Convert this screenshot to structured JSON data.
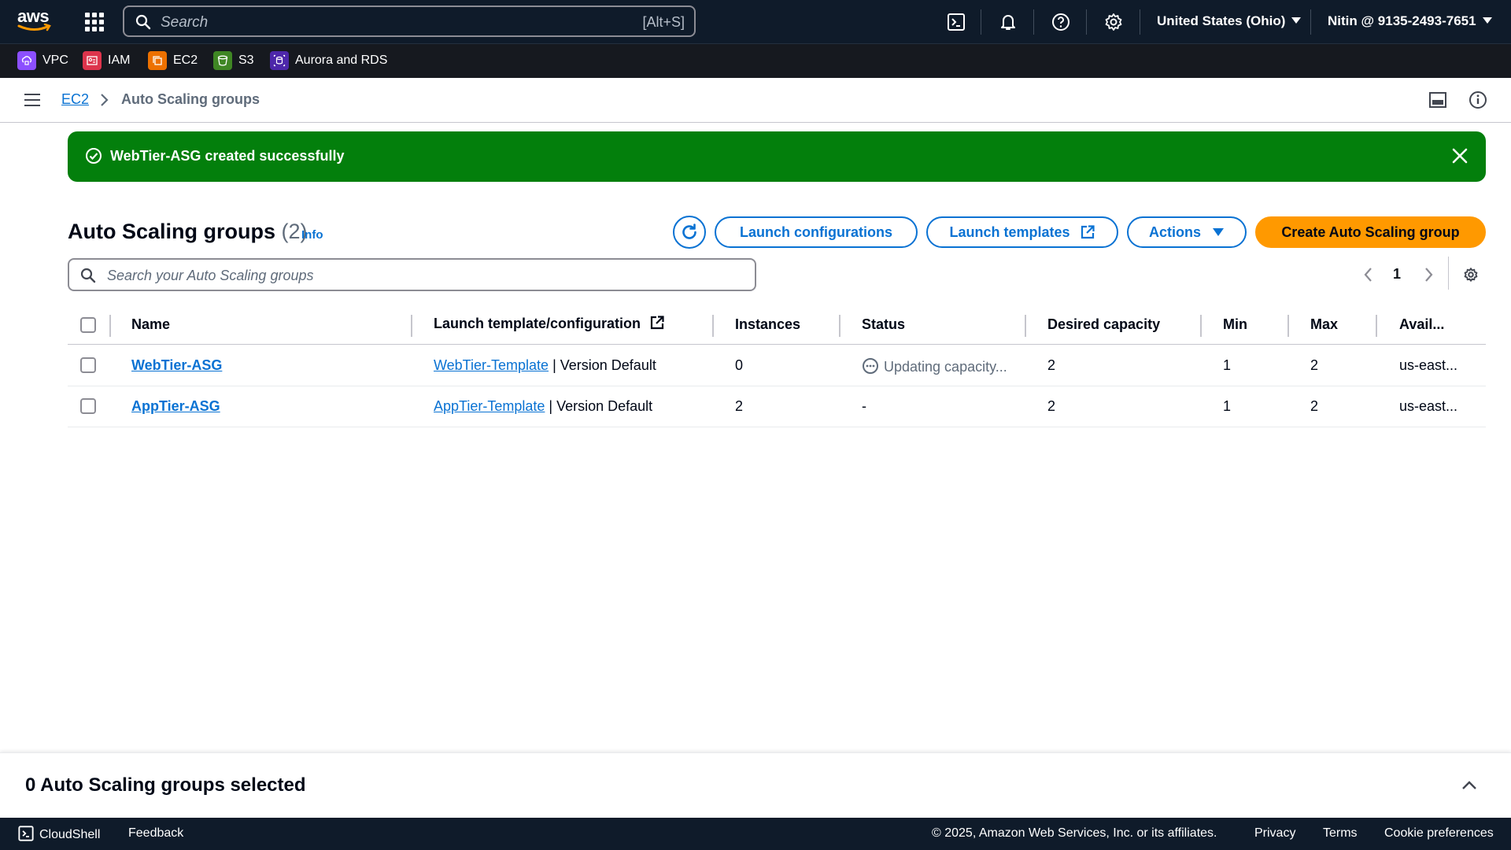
{
  "topnav": {
    "search_placeholder": "Search",
    "search_shortcut": "[Alt+S]",
    "region": "United States (Ohio)",
    "account": "Nitin @ 9135-2493-7651"
  },
  "favorites": [
    {
      "label": "VPC",
      "color": "#8c4fff"
    },
    {
      "label": "IAM",
      "color": "#dd344c"
    },
    {
      "label": "EC2",
      "color": "#ed7100"
    },
    {
      "label": "S3",
      "color": "#3f8624"
    },
    {
      "label": "Aurora and RDS",
      "color": "#4d27aa"
    }
  ],
  "breadcrumb": {
    "root": "EC2",
    "current": "Auto Scaling groups"
  },
  "flash": {
    "message": "WebTier-ASG created successfully"
  },
  "header": {
    "title": "Auto Scaling groups",
    "count": "(2)",
    "info": "Info",
    "launch_configurations": "Launch configurations",
    "launch_templates": "Launch templates",
    "actions": "Actions",
    "create": "Create Auto Scaling group"
  },
  "search": {
    "placeholder": "Search your Auto Scaling groups"
  },
  "pager": {
    "page": "1"
  },
  "table": {
    "columns": {
      "name": "Name",
      "template": "Launch template/configuration",
      "instances": "Instances",
      "status": "Status",
      "desired": "Desired capacity",
      "min": "Min",
      "max": "Max",
      "avail": "Avail..."
    },
    "rows": [
      {
        "name": "WebTier-ASG",
        "template": "WebTier-Template",
        "version": "| Version Default",
        "instances": "0",
        "status": "Updating capacity...",
        "desired": "2",
        "min": "1",
        "max": "2",
        "avail": "us-east..."
      },
      {
        "name": "AppTier-ASG",
        "template": "AppTier-Template",
        "version": "| Version Default",
        "instances": "2",
        "status": "-",
        "desired": "2",
        "min": "1",
        "max": "2",
        "avail": "us-east..."
      }
    ]
  },
  "split_panel": {
    "title": "0 Auto Scaling groups selected"
  },
  "footer": {
    "cloudshell": "CloudShell",
    "feedback": "Feedback",
    "copyright": "© 2025, Amazon Web Services, Inc. or its affiliates.",
    "privacy": "Privacy",
    "terms": "Terms",
    "cookies": "Cookie preferences"
  }
}
